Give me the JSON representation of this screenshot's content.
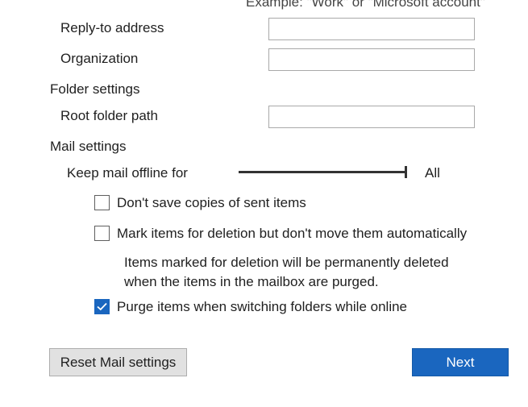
{
  "example_hint": "Example: \"Work\" or \"Microsoft account\"",
  "fields": {
    "reply_to": {
      "label": "Reply-to address",
      "value": ""
    },
    "organization": {
      "label": "Organization",
      "value": ""
    },
    "root_folder": {
      "label": "Root folder path",
      "value": ""
    }
  },
  "sections": {
    "folder_settings": "Folder settings",
    "mail_settings": "Mail settings"
  },
  "offline": {
    "label": "Keep mail offline for",
    "value_label": "All",
    "slider_level_fraction": 1.0
  },
  "options": [
    {
      "label": "Don't save copies of sent items",
      "checked": false
    },
    {
      "label": "Mark items for deletion but don't move them automatically",
      "checked": false
    },
    {
      "label": "Purge items when switching folders while online",
      "checked": true
    }
  ],
  "deletion_note": {
    "line1": "Items marked for deletion will be permanently deleted",
    "line2": "when the items in the mailbox are purged."
  },
  "buttons": {
    "reset": "Reset Mail settings",
    "next": "Next"
  },
  "colors": {
    "accent": "#1a66bf",
    "secondary_button_bg": "#e1e1e1",
    "input_border": "#a9a9a9"
  },
  "icons": {
    "checkmark": "check-icon"
  }
}
